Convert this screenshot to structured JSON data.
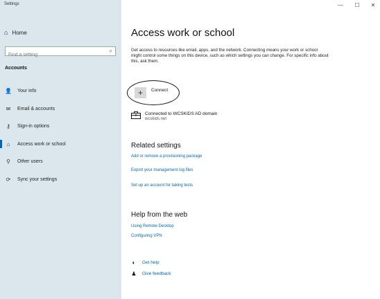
{
  "window": {
    "title": "Settings",
    "min_glyph": "—",
    "max_glyph": "☐",
    "close_glyph": "✕"
  },
  "sidebar": {
    "home_label": "Home",
    "search_placeholder": "Find a setting",
    "section_heading": "Accounts",
    "items": [
      {
        "label": "Your info",
        "icon": "person-card-icon",
        "glyph": "👤"
      },
      {
        "label": "Email & accounts",
        "icon": "mail-icon",
        "glyph": "✉"
      },
      {
        "label": "Sign-in options",
        "icon": "key-icon",
        "glyph": "⚷"
      },
      {
        "label": "Access work or school",
        "icon": "briefcase-icon",
        "glyph": "⌂"
      },
      {
        "label": "Other users",
        "icon": "person-add-icon",
        "glyph": "⚲"
      },
      {
        "label": "Sync your settings",
        "icon": "sync-icon",
        "glyph": "⟳"
      }
    ],
    "active_index": 3
  },
  "main": {
    "title": "Access work or school",
    "description": "Get access to resources like email, apps, and the network. Connecting means your work or school might control some things on this device, such as which settings you can change. For specific info about this, ask them.",
    "connect_label": "Connect",
    "connect_glyph": "+",
    "account": {
      "name": "Connected to WCSKIDS AD domain",
      "domain": "wcskids.net"
    },
    "related": {
      "heading": "Related settings",
      "links": [
        "Add or remove a provisioning package",
        "Export your management log files",
        "Set up an account for taking tests"
      ]
    },
    "help": {
      "heading": "Help from the web",
      "links": [
        "Using Remote Desktop",
        "Configuring VPN"
      ]
    },
    "get_help": "Get help",
    "give_feedback": "Give feedback"
  }
}
